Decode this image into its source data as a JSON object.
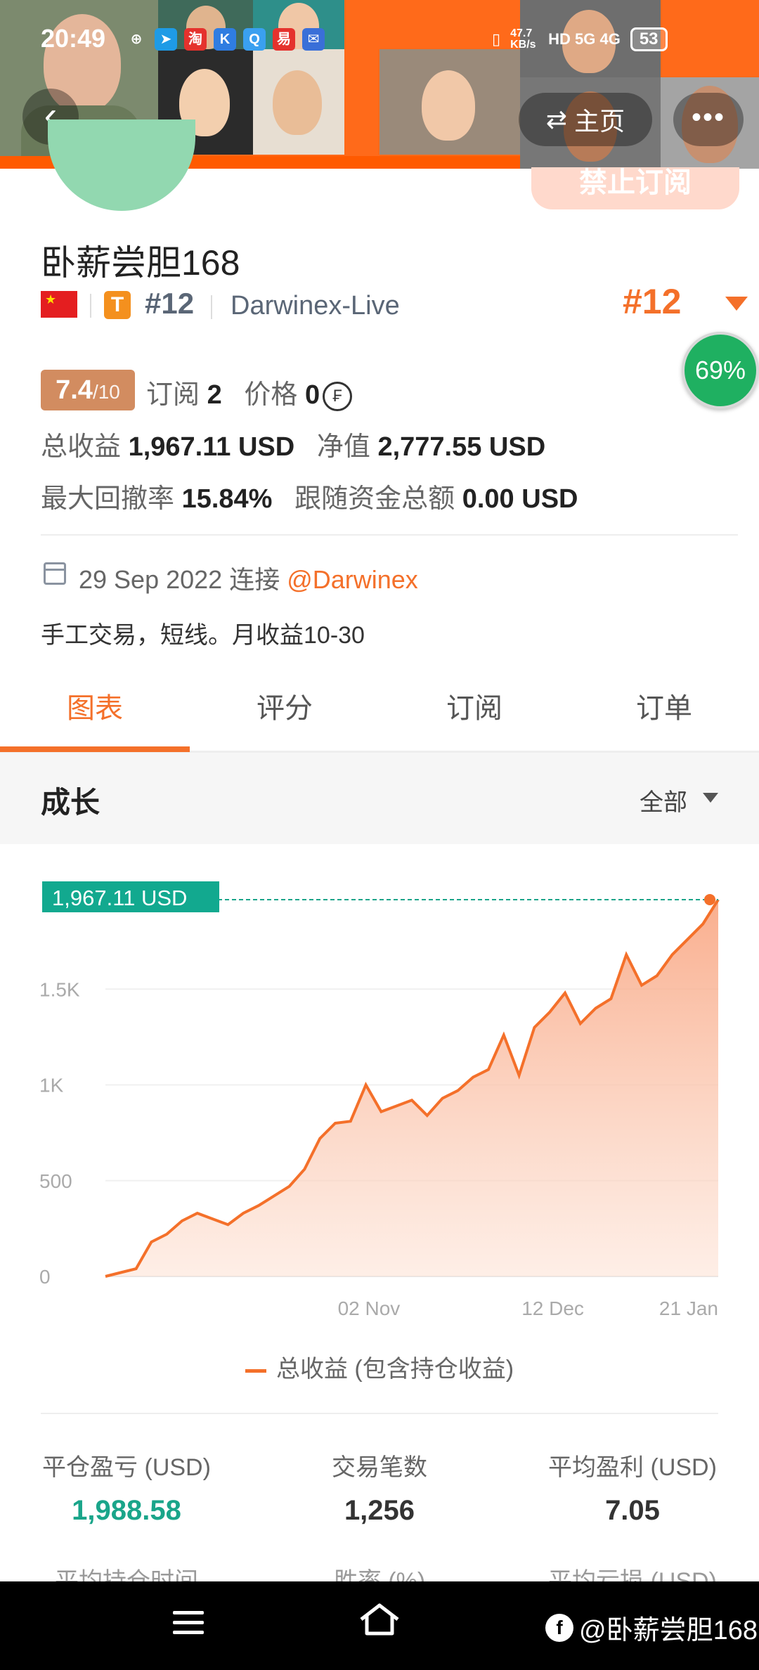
{
  "status_bar": {
    "time": "20:49",
    "net_speed": "47.7 KB/s",
    "signal": "HD 5G 4G",
    "battery": "53"
  },
  "nav": {
    "back_icon": "back-icon",
    "home_label": "主页",
    "home_icon": "swap-icon",
    "more_label": "•••"
  },
  "profile": {
    "unsubscribe_label": "禁止订阅",
    "name": "卧薪尝胆168",
    "flag": "cn-flag",
    "tier": "T",
    "rank_small": "#12",
    "broker": "Darwinex-Live",
    "rank_big": "#12",
    "percent": "69%",
    "score": "7.4",
    "score_max": "/10",
    "subs_label": "订阅",
    "subs_value": "2",
    "price_label": "价格",
    "price_value": "0",
    "price_icon": "coin-icon",
    "total_profit_label": "总收益",
    "total_profit_value": "1,967.11 USD",
    "equity_label": "净值",
    "equity_value": "2,777.55 USD",
    "max_dd_label": "最大回撤率",
    "max_dd_value": "15.84%",
    "follow_funds_label": "跟随资金总额",
    "follow_funds_value": "0.00 USD",
    "joined_date": "29 Sep 2022 连接",
    "joined_via": "@Darwinex",
    "bio": "手工交易，短线。月收益10-30"
  },
  "tabs": [
    {
      "label": "图表",
      "active": true
    },
    {
      "label": "评分",
      "active": false
    },
    {
      "label": "订阅",
      "active": false
    },
    {
      "label": "订单",
      "active": false
    }
  ],
  "growth": {
    "title": "成长",
    "range": "全部"
  },
  "chart_data": {
    "type": "area",
    "title": "",
    "current_label": "1,967.11 USD",
    "y_ticks": [
      "0",
      "500",
      "1K",
      "1.5K"
    ],
    "x_ticks": [
      "02 Nov",
      "12 Dec",
      "21 Jan"
    ],
    "ylim": [
      0,
      2000
    ],
    "legend": "总收益 (包含持仓收益)",
    "series": [
      {
        "name": "总收益 (包含持仓收益)",
        "values": [
          0,
          20,
          40,
          180,
          220,
          290,
          330,
          300,
          270,
          330,
          370,
          420,
          470,
          560,
          720,
          800,
          810,
          1000,
          860,
          890,
          920,
          840,
          930,
          970,
          1040,
          1080,
          1260,
          1050,
          1300,
          1380,
          1480,
          1320,
          1400,
          1450,
          1680,
          1520,
          1570,
          1680,
          1760,
          1840,
          1967.11
        ]
      }
    ],
    "color": "#f4702a"
  },
  "metrics": [
    {
      "label": "平仓盈亏 (USD)",
      "value": "1,988.58",
      "green": true
    },
    {
      "label": "交易笔数",
      "value": "1,256",
      "green": false
    },
    {
      "label": "平均盈利 (USD)",
      "value": "7.05",
      "green": false
    }
  ],
  "metrics_partial": [
    "平均持仓时间",
    "胜率 (%)",
    "平均亏损 (USD)"
  ],
  "bottom_nav": {
    "menu_icon": "menu-icon",
    "home_icon": "home-icon",
    "watermark": "@卧薪尝胆168"
  }
}
